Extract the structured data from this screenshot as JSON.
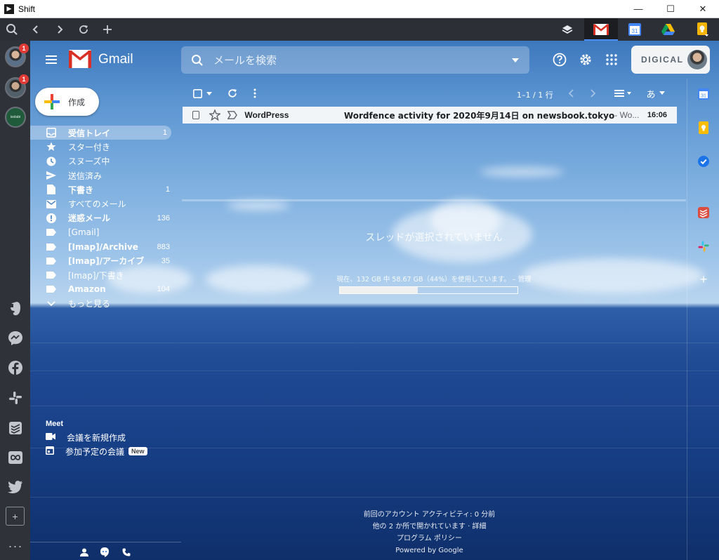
{
  "window": {
    "title": "Shift",
    "minimize": "—",
    "maximize": "☐",
    "close": "✕"
  },
  "toolbar": {
    "app_tabs": [
      {
        "name": "layers-icon"
      },
      {
        "name": "gmail-icon",
        "active": true
      },
      {
        "name": "google-calendar-icon",
        "text": "31"
      },
      {
        "name": "google-drive-icon"
      },
      {
        "name": "google-keep-icon"
      }
    ]
  },
  "shift_sidebar": {
    "accounts": [
      {
        "badge": "1"
      },
      {
        "badge": "1"
      },
      {
        "label": "isolabi"
      }
    ],
    "add_label": "+",
    "more_label": "···"
  },
  "gmail": {
    "logo_text": "Gmail",
    "search_placeholder": "メールを検索",
    "account_brand": "DIGICAL",
    "compose_label": "作成",
    "nav": [
      {
        "label": "受信トレイ",
        "count": "1",
        "bold": true,
        "active": true,
        "icon": "inbox-icon"
      },
      {
        "label": "スター付き",
        "count": "",
        "icon": "star-icon"
      },
      {
        "label": "スヌーズ中",
        "count": "",
        "icon": "clock-icon"
      },
      {
        "label": "送信済み",
        "count": "",
        "icon": "send-icon"
      },
      {
        "label": "下書き",
        "count": "1",
        "bold": true,
        "icon": "draft-icon"
      },
      {
        "label": "すべてのメール",
        "count": "",
        "icon": "mail-icon"
      },
      {
        "label": "迷惑メール",
        "count": "136",
        "bold": true,
        "icon": "spam-icon"
      },
      {
        "label": "[Gmail]",
        "count": "",
        "icon": "label-icon"
      },
      {
        "label": "[Imap]/Archive",
        "count": "883",
        "bold": true,
        "icon": "label-icon"
      },
      {
        "label": "[Imap]/アーカイブ",
        "count": "35",
        "bold": true,
        "icon": "label-icon"
      },
      {
        "label": "[Imap]/下書き",
        "count": "",
        "icon": "label-icon"
      },
      {
        "label": "Amazon",
        "count": "104",
        "bold": true,
        "icon": "label-icon"
      },
      {
        "label": "もっと見る",
        "count": "",
        "icon": "chevron-down-icon"
      }
    ],
    "meet": {
      "title": "Meet",
      "new_meeting": "会議を新規作成",
      "join_meeting": "参加予定の会議",
      "new_badge": "New"
    },
    "list": {
      "range": "1–1 / 1 行",
      "input_tool": "あ",
      "messages": [
        {
          "sender": "WordPress",
          "subject": "Wordfence activity for 2020年9月14日 on newsbook.tokyo",
          "snippet": " - Wo...",
          "time": "16:06"
        }
      ]
    },
    "empty_state": "スレッドが選択されていません",
    "storage": {
      "text": "現在、132 GB 中 58.67 GB（44%）を使用しています。 – 管理",
      "used_fraction": 0.44
    },
    "footer": [
      "前回のアカウント アクティビティ: 0 分前",
      "他の 2 か所で開かれています · 詳細",
      "プログラム ポリシー",
      "Powered by Google"
    ],
    "side_panel": [
      {
        "name": "calendar-icon",
        "text": "31"
      },
      {
        "name": "keep-icon"
      },
      {
        "name": "tasks-icon"
      },
      {
        "name": "todoist-icon"
      },
      {
        "name": "slack-icon"
      },
      {
        "name": "add-addon-icon",
        "text": "+"
      }
    ]
  }
}
